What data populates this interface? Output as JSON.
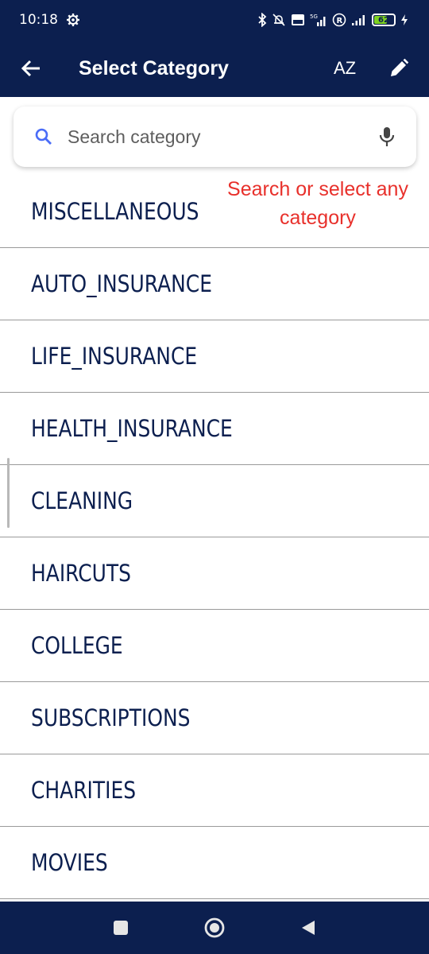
{
  "status": {
    "time": "10:18",
    "battery": "62",
    "icons": [
      "settings-gear-icon",
      "bluetooth-icon",
      "mute-bell-icon",
      "volte-icon",
      "5g-signal-icon",
      "roaming-r-icon",
      "signal-icon",
      "battery-icon",
      "charging-bolt-icon"
    ]
  },
  "app_bar": {
    "title": "Select Category",
    "sort_label": "AZ",
    "back_icon": "back-arrow-icon",
    "edit_icon": "pencil-icon"
  },
  "search": {
    "placeholder": "Search category",
    "value": "",
    "search_icon": "search-icon",
    "mic_icon": "mic-icon"
  },
  "hint": {
    "text": "Search or select any category",
    "color": "#e8302b"
  },
  "categories": [
    "MISCELLANEOUS",
    "AUTO_INSURANCE",
    "LIFE_INSURANCE",
    "HEALTH_INSURANCE",
    "CLEANING",
    "HAIRCUTS",
    "COLLEGE",
    "SUBSCRIPTIONS",
    "CHARITIES",
    "MOVIES"
  ],
  "colors": {
    "primary": "#0c1f4f",
    "accent": "#4a6cf7",
    "text": "#0c1f4f"
  },
  "nav": {
    "recents_icon": "square-recents-icon",
    "home_icon": "circle-home-icon",
    "back_icon": "triangle-back-icon"
  }
}
